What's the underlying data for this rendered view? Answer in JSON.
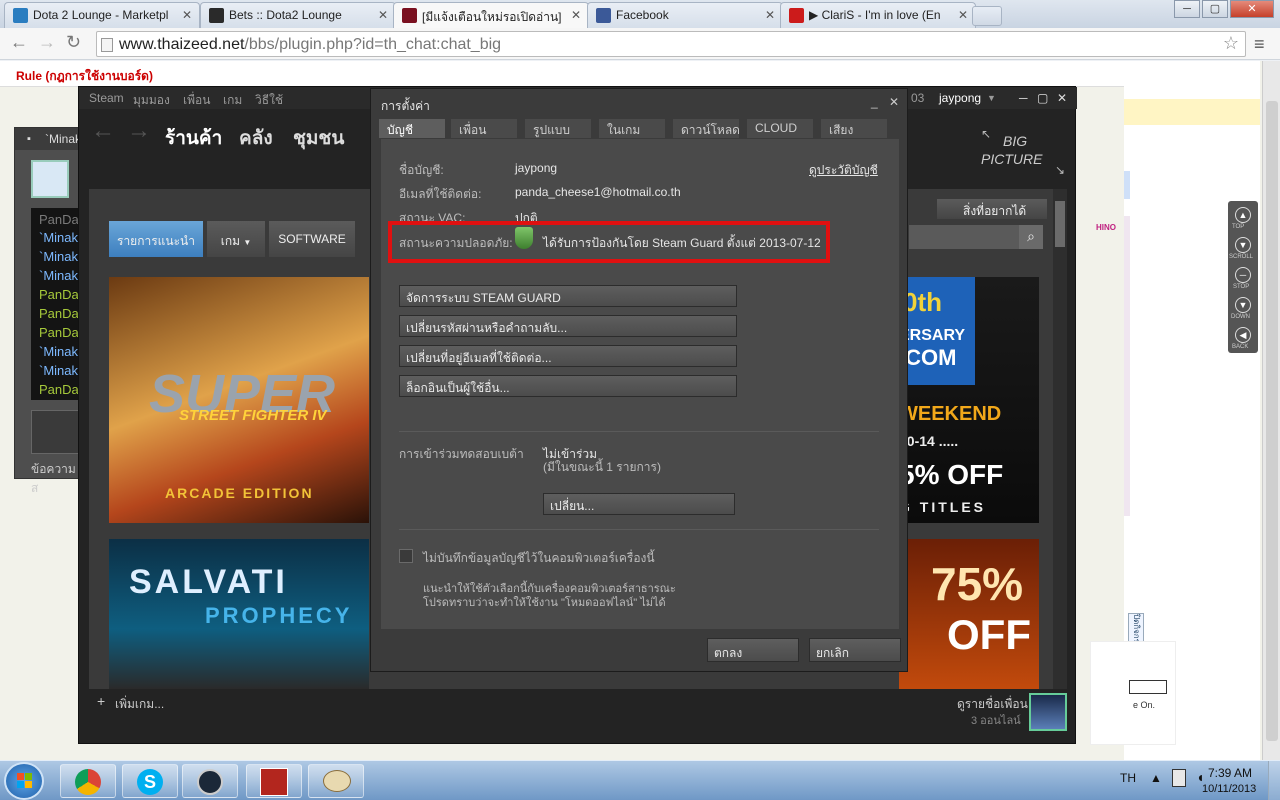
{
  "browser": {
    "tabs": [
      {
        "title": "Dota 2 Lounge - Marketpl",
        "fav_color": "#2a7dc0"
      },
      {
        "title": "Bets :: Dota2 Lounge",
        "fav_color": "#2a2a2a"
      },
      {
        "title": "[มีแจ้งเตือนใหม่รอเปิดอ่าน] ",
        "fav_color": "#7a1020"
      },
      {
        "title": "Facebook",
        "fav_color": "#3b5998"
      },
      {
        "title": "▶ ClariS - I'm in love (En",
        "fav_color": "#cc1b1b"
      }
    ],
    "url_domain": "www.thaizeed.net",
    "url_path": "/bbs/plugin.php?id=th_chat:chat_big"
  },
  "page": {
    "rule_text": "Rule (กฎการใช้งานบอร์ด)"
  },
  "chat_window": {
    "title": "`Minak",
    "names": [
      {
        "text": "PanDa",
        "color": "#7a7a7a"
      },
      {
        "text": "`Minak",
        "color": "#7db9ff"
      },
      {
        "text": "`Minak",
        "color": "#7db9ff"
      },
      {
        "text": "`Minak",
        "color": "#7db9ff"
      },
      {
        "text": "PanDa",
        "color": "#a6c93b"
      },
      {
        "text": "PanDa",
        "color": "#a6c93b"
      },
      {
        "text": "PanDa",
        "color": "#a6c93b"
      },
      {
        "text": "`Minak",
        "color": "#7db9ff"
      },
      {
        "text": "`Minak",
        "color": "#7db9ff"
      },
      {
        "text": "PanDa",
        "color": "#a6c93b"
      }
    ],
    "footer": "ข้อความส"
  },
  "steam": {
    "menu": [
      "Steam",
      "มุมมอง",
      "เพื่อน",
      "เกม",
      "วิธีใช้"
    ],
    "nav": [
      "ร้านค้า",
      "คลัง",
      "ชุมชน"
    ],
    "user": "jaypong",
    "big_picture": [
      "BIG",
      "PICTURE"
    ],
    "store_tabs": [
      "รายการแนะนำ",
      "เกม",
      "SOFTWARE"
    ],
    "wishlist": "สิ่งที่อยากได้",
    "add_game": "เพิ่มเกม...",
    "friends_label": "ดูรายชื่อเพื่อน",
    "friends_online": "3 ออนไลน์",
    "banner1_title": "SUPER",
    "banner1_sub": "STREET FIGHTER IV",
    "banner1_edition": "ARCADE EDITION",
    "banner2_title": "SALVATI",
    "banner2_sub": "PROPHECY",
    "banner3_line1": "0th",
    "banner3_line2": "ERSARY",
    "banner3_line3": ".COM",
    "banner3_weekend": "WEEKEND",
    "banner3_dates": "10-14 .....",
    "banner3_off": "5% OFF",
    "banner3_titles": "G TITLES",
    "banner4_pct": "75%",
    "banner4_off": "OFF",
    "partial_count": "03"
  },
  "dialog": {
    "title": "การตั้งค่า",
    "tabs": [
      "บัญชี",
      "เพื่อน",
      "รูปแบบ",
      "ในเกม",
      "ดาวน์โหลด",
      "CLOUD",
      "เสียง"
    ],
    "account_label": "ชื่อบัญชี:",
    "account_value": "jaypong",
    "history_link": "ดูประวัติบัญชี",
    "email_label": "อีเมลที่ใช้ติดต่อ:",
    "email_value": "panda_cheese1@hotmail.co.th",
    "vac_label": "สถานะ VAC:",
    "vac_value": "ปกติ",
    "security_label": "สถานะความปลอดภัย:",
    "security_value": "ได้รับการป้องกันโดย Steam Guard ตั้งแต่ 2013-07-12",
    "buttons": [
      "จัดการระบบ STEAM GUARD",
      "เปลี่ยนรหัสผ่านหรือคำถามลับ...",
      "เปลี่ยนที่อยู่อีเมลที่ใช้ติดต่อ...",
      "ล็อกอินเป็นผู้ใช้อื่น..."
    ],
    "beta_label": "การเข้าร่วมทดสอบเบต้า",
    "beta_value": "ไม่เข้าร่วม",
    "beta_sub": "(มีในขณะนี้ 1 รายการ)",
    "beta_change": "เปลี่ยน...",
    "checkbox_label": "ไม่บันทึกข้อมูลบัญชีไว้ในคอมพิวเตอร์เครื่องนี้",
    "note_line1": "แนะนำให้ใช้ตัวเลือกนี้กับเครื่องคอมพิวเตอร์สาธารณะ",
    "note_line2": "โปรดทราบว่าจะทำให้ใช้งาน \"โหมดออฟไลน์\" ไม่ได้",
    "ok": "ตกลง",
    "cancel": "ยกเลิก"
  },
  "right_tools": [
    "TOP",
    "SCROLL",
    "STOP",
    "DOWN",
    "BACK"
  ],
  "right_misc": {
    "vertical_tag": "ปิดกิจกรรม",
    "logo_text": "HINO",
    "mini_text": "e On."
  },
  "taskbar": {
    "lang": "TH",
    "time": "7:39 AM",
    "date": "10/11/2013"
  }
}
